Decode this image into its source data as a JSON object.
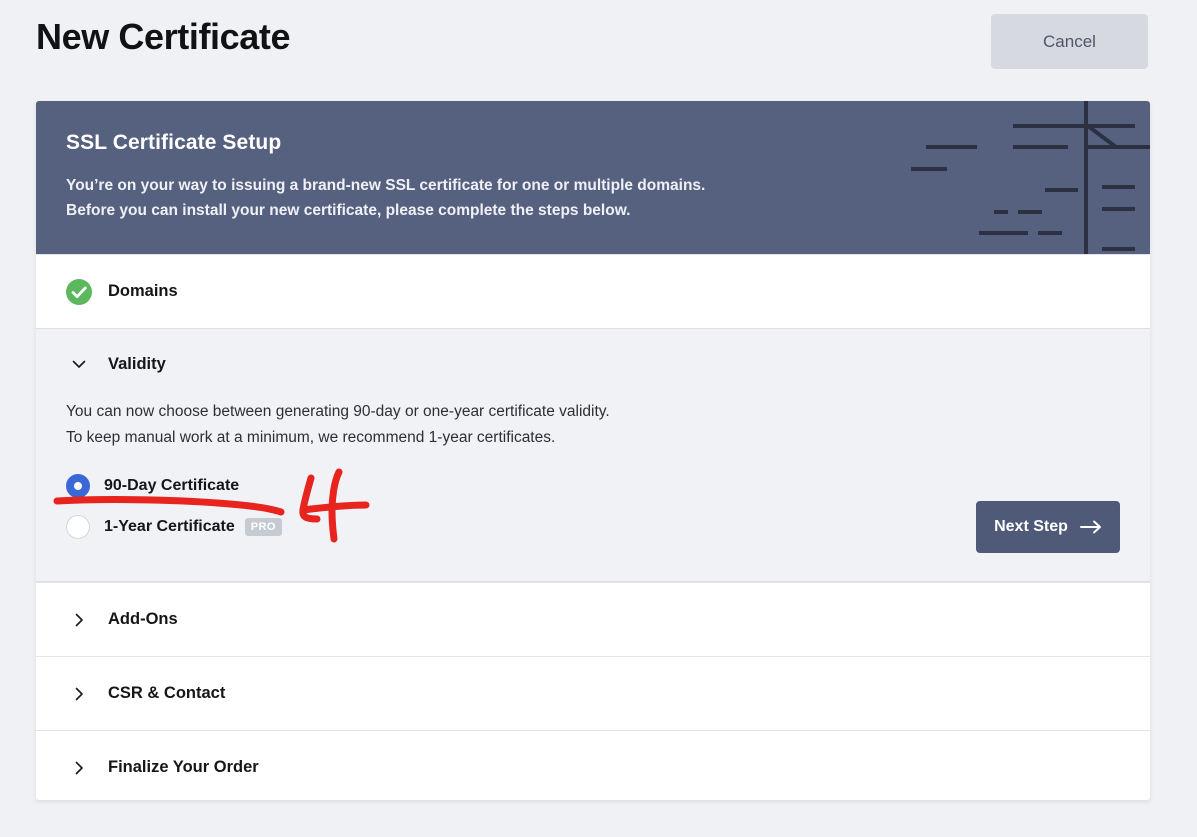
{
  "page": {
    "title": "New Certificate",
    "cancel_label": "Cancel",
    "background_color": "#f0f1f4"
  },
  "banner": {
    "title": "SSL Certificate Setup",
    "line1": "You’re on your way to issuing a brand-new SSL certificate for one or multiple domains.",
    "line2": "Before you can install your new certificate, please complete the steps below.",
    "background_color": "#566180",
    "art_name": "certificate-line-art"
  },
  "steps": [
    {
      "id": "domains",
      "label": "Domains",
      "state": "completed",
      "icon": "check-circle-icon"
    },
    {
      "id": "validity",
      "label": "Validity",
      "state": "expanded",
      "icon": "chevron-down-icon"
    },
    {
      "id": "addons",
      "label": "Add-Ons",
      "state": "collapsed",
      "icon": "chevron-right-icon"
    },
    {
      "id": "csr-contact",
      "label": "CSR & Contact",
      "state": "collapsed",
      "icon": "chevron-right-icon"
    },
    {
      "id": "finalize",
      "label": "Finalize Your Order",
      "state": "collapsed",
      "icon": "chevron-right-icon"
    }
  ],
  "validity": {
    "desc_line1": "You can now choose between generating 90-day or one-year certificate validity.",
    "desc_line2": "To keep manual work at a minimum, we recommend 1-year certificates.",
    "options": [
      {
        "id": "90-day",
        "label": "90-Day Certificate",
        "selected": true,
        "badge": null
      },
      {
        "id": "1-year",
        "label": "1-Year Certificate",
        "selected": false,
        "badge": "PRO"
      }
    ],
    "next_step_label": "Next Step",
    "next_step_icon": "arrow-right-icon",
    "selected_color": "#3a68d6",
    "button_color": "#4f5a79"
  },
  "annotation": {
    "color": "#e8241e",
    "marks": [
      "underline-under-90-day-option",
      "handwritten-number-4"
    ],
    "number": "4"
  }
}
